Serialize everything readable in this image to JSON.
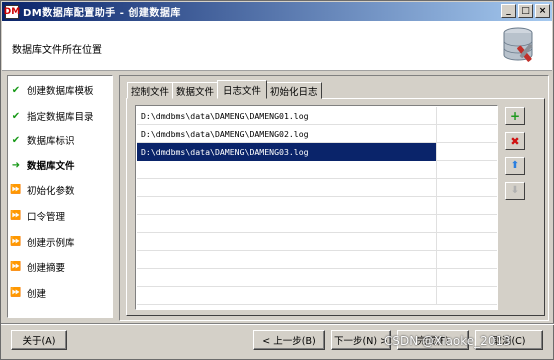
{
  "window": {
    "title": "DM数据库配置助手 - 创建数据库",
    "app_icon_text": "DM",
    "controls": {
      "minimize": "_",
      "maximize": "□",
      "close": "×"
    }
  },
  "header": {
    "text": "数据库文件所在位置",
    "icon": "database-tools-icon"
  },
  "steps": [
    {
      "label": "创建数据库模板",
      "state": "done"
    },
    {
      "label": "指定数据库目录",
      "state": "done"
    },
    {
      "label": "数据库标识",
      "state": "done"
    },
    {
      "label": "数据库文件",
      "state": "current"
    },
    {
      "label": "初始化参数",
      "state": "todo"
    },
    {
      "label": "口令管理",
      "state": "todo"
    },
    {
      "label": "创建示例库",
      "state": "todo"
    },
    {
      "label": "创建摘要",
      "state": "todo"
    },
    {
      "label": "创建",
      "state": "todo"
    }
  ],
  "tabs": [
    {
      "label": "控制文件",
      "selected": false
    },
    {
      "label": "数据文件",
      "selected": false
    },
    {
      "label": "日志文件",
      "selected": true
    },
    {
      "label": "初始化日志",
      "selected": false
    }
  ],
  "log_files": [
    {
      "path": "D:\\dmdbms\\data\\DAMENG\\DAMENG01.log",
      "size": "",
      "selected": false
    },
    {
      "path": "D:\\dmdbms\\data\\DAMENG\\DAMENG02.log",
      "size": "",
      "selected": false
    },
    {
      "path": "D:\\dmdbms\\data\\DAMENG\\DAMENG03.log",
      "size": "",
      "selected": true
    }
  ],
  "side_buttons": {
    "add": "+",
    "delete": "✖",
    "move_up": "⬆",
    "move_down": "⬇"
  },
  "footer": {
    "about": "关于(A)",
    "prev": "< 上一步(B)",
    "next": "下一步(N) >",
    "finish": "完成(F)",
    "cancel": "取消(C)"
  },
  "watermark": "CSDN @Xiaoke_2013",
  "colors": {
    "done": "#1a9a1a",
    "todo": "#2a6fd8",
    "selection": "#0a246a",
    "titlebar_start": "#0a246a",
    "titlebar_end": "#a6caf0"
  }
}
